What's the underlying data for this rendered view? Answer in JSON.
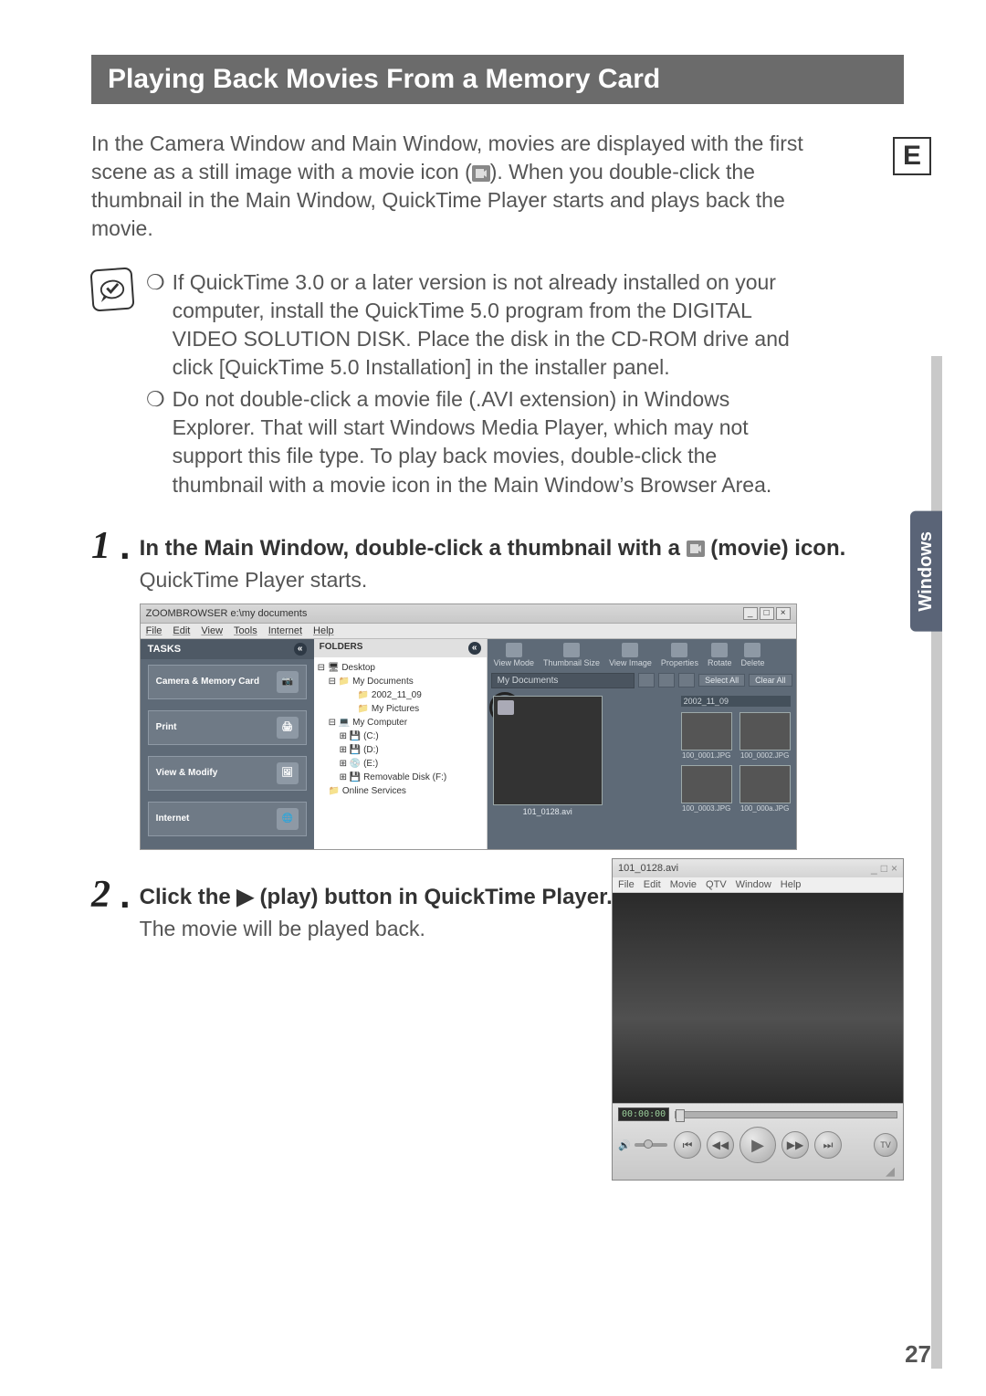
{
  "badge": "E",
  "section_title": "Playing Back Movies From a Memory Card",
  "intro": "In the Camera Window and Main Window, movies are displayed with the first scene as a still image with a movie icon (  ). When you double-click the thumbnail in the Main Window, QuickTime Player starts and plays back the movie.",
  "notes": [
    "If QuickTime 3.0 or a later version is not already installed on your computer, install the QuickTime 5.0 program from the DIGITAL VIDEO SOLUTION DISK.  Place the disk in the CD-ROM drive and click [QuickTime 5.0 Installation] in the installer panel.",
    "Do not double-click a movie file (.AVI extension) in Windows Explorer.  That will start Windows Media Player, which may not support this file type. To play back movies, double-click the thumbnail with a movie icon in the Main Window’s Browser Area."
  ],
  "steps": [
    {
      "num": "1",
      "heading_a": "In the Main Window, double-click a thumbnail with a ",
      "heading_b": " (movie) icon.",
      "sub": "QuickTime Player starts."
    },
    {
      "num": "2",
      "heading": "Click the ▶ (play) button in QuickTime Player.",
      "sub": "The movie will be played back."
    }
  ],
  "zoombrowser": {
    "title": "ZOOMBROWSER e:\\my documents",
    "menus": [
      "File",
      "Edit",
      "View",
      "Tools",
      "Internet",
      "Help"
    ],
    "tasks_header": "TASKS",
    "task_buttons": [
      "Camera & Memory Card",
      "Print",
      "View & Modify",
      "Internet"
    ],
    "folders_header": "FOLDERS",
    "tree": {
      "root": "Desktop",
      "nodes": [
        "My Documents",
        "2002_11_09",
        "My Pictures",
        "My Computer",
        "(C:)",
        "(D:)",
        "(E:)",
        "Removable Disk (F:)",
        "Online Services"
      ]
    },
    "toolbar": [
      "View Mode",
      "Thumbnail Size",
      "View Image",
      "Properties",
      "Rotate",
      "Delete"
    ],
    "path": "My Documents",
    "actions": [
      "Select All",
      "Clear All"
    ],
    "large_thumb_caption": "101_0128.avi",
    "date_header": "2002_11_09",
    "small_thumbs": [
      "100_0001.JPG",
      "100_0002.JPG",
      "100_0003.JPG",
      "100_000a.JPG"
    ]
  },
  "quicktime": {
    "title": "101_0128.avi",
    "menus": [
      "File",
      "Edit",
      "Movie",
      "QTV",
      "Window",
      "Help"
    ],
    "time": "00:00:00",
    "tv": "TV"
  },
  "side_tab": "Windows",
  "page_number": "27"
}
